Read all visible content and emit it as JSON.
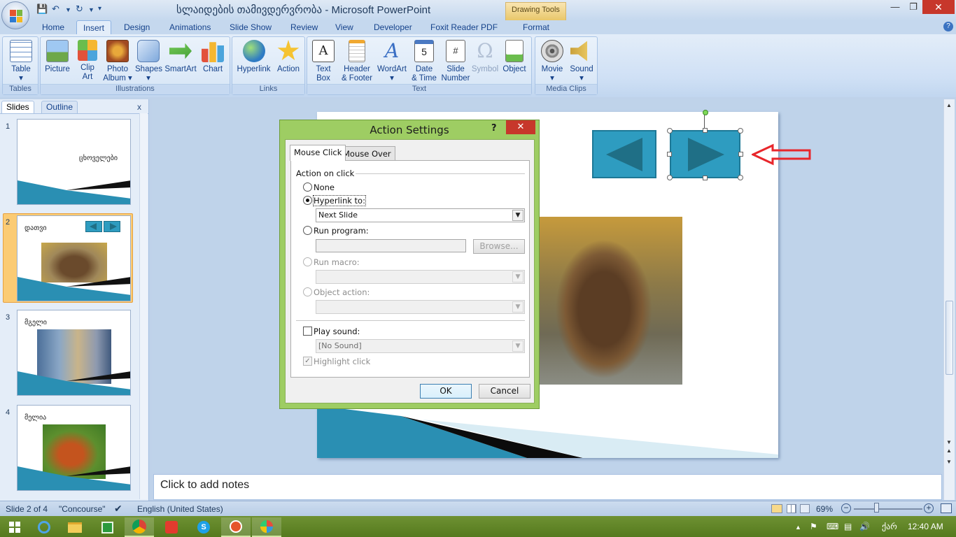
{
  "window": {
    "title": "სლაიდების თამივდერვრობა - Microsoft PowerPoint",
    "contextual_tab_group": "Drawing Tools"
  },
  "tabs": [
    "Home",
    "Insert",
    "Design",
    "Animations",
    "Slide Show",
    "Review",
    "View",
    "Developer",
    "Foxit Reader PDF",
    "Format"
  ],
  "active_tab": "Insert",
  "ribbon": {
    "groups": [
      {
        "label": "Tables",
        "buttons": [
          "Table"
        ]
      },
      {
        "label": "Illustrations",
        "buttons": [
          "Picture",
          "Clip Art",
          "Photo Album",
          "Shapes",
          "SmartArt",
          "Chart"
        ]
      },
      {
        "label": "Links",
        "buttons": [
          "Hyperlink",
          "Action"
        ]
      },
      {
        "label": "Text",
        "buttons": [
          "Text Box",
          "Header & Footer",
          "WordArt",
          "Date & Time",
          "Slide Number",
          "Symbol",
          "Object"
        ]
      },
      {
        "label": "Media Clips",
        "buttons": [
          "Movie",
          "Sound"
        ]
      }
    ],
    "table": {
      "l1": "Table"
    },
    "picture": {
      "l1": "Picture"
    },
    "clipart": {
      "l1": "Clip",
      "l2": "Art"
    },
    "photoalbum": {
      "l1": "Photo",
      "l2": "Album"
    },
    "shapes": {
      "l1": "Shapes"
    },
    "smartart": {
      "l1": "SmartArt"
    },
    "chart": {
      "l1": "Chart"
    },
    "hyperlink": {
      "l1": "Hyperlink"
    },
    "action": {
      "l1": "Action"
    },
    "textbox": {
      "l1": "Text",
      "l2": "Box"
    },
    "headerfooter": {
      "l1": "Header",
      "l2": "& Footer"
    },
    "wordart": {
      "l1": "WordArt"
    },
    "datetime": {
      "l1": "Date",
      "l2": "& Time"
    },
    "slidenumber": {
      "l1": "Slide",
      "l2": "Number"
    },
    "symbol": {
      "l1": "Symbol"
    },
    "object": {
      "l1": "Object"
    },
    "movie": {
      "l1": "Movie"
    },
    "sound": {
      "l1": "Sound"
    }
  },
  "slides_panel": {
    "tabs": [
      "Slides",
      "Outline"
    ],
    "close_glyph": "x",
    "slides": [
      {
        "number": "1",
        "title": "ცხოველები"
      },
      {
        "number": "2",
        "title": "დათვი"
      },
      {
        "number": "3",
        "title": "მგელი"
      },
      {
        "number": "4",
        "title": "მელია"
      }
    ]
  },
  "notes": {
    "placeholder": "Click to add notes"
  },
  "dialog": {
    "title": "Action Settings",
    "help_glyph": "?",
    "close_glyph": "✕",
    "tabs": [
      "Mouse Click",
      "Mouse Over"
    ],
    "section_label": "Action on click",
    "options": {
      "none": "None",
      "hyperlink": "Hyperlink to:",
      "hyperlink_value": "Next Slide",
      "run_program": "Run program:",
      "browse": "Browse...",
      "run_macro": "Run macro:",
      "object_action": "Object action:",
      "play_sound": "Play sound:",
      "sound_value": "[No Sound]",
      "highlight_click": "Highlight click"
    },
    "selected_option": "hyperlink",
    "highlight_click_checked": true,
    "play_sound_checked": false,
    "ok": "OK",
    "cancel": "Cancel"
  },
  "statusbar": {
    "slide_info": "Slide 2 of 4",
    "theme": "\"Concourse\"",
    "language": "English (United States)",
    "zoom": "69%"
  },
  "taskbar": {
    "time": "12:40 AM",
    "lang": "ქარ"
  },
  "colors": {
    "accent": "#2e9cc0",
    "annotation_arrow": "#e8262b",
    "dialog_frame": "#9ecd63"
  }
}
